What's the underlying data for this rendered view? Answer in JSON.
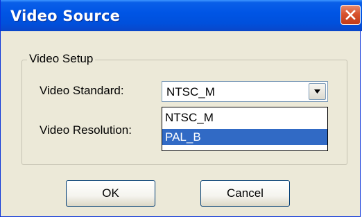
{
  "window": {
    "title": "Video Source"
  },
  "group": {
    "label": "Video Setup"
  },
  "fields": {
    "standard_label": "Video Standard:",
    "resolution_label": "Video Resolution:"
  },
  "combo": {
    "selected_value": "NTSC_M",
    "options": [
      "NTSC_M",
      "PAL_B"
    ],
    "highlighted_option": "PAL_B"
  },
  "buttons": {
    "ok": "OK",
    "cancel": "Cancel"
  },
  "icons": {
    "close": "close-icon",
    "dropdown": "chevron-down-icon"
  },
  "colors": {
    "titlebar": "#0055e5",
    "close_button": "#d8532e",
    "selection": "#316ac5",
    "dialog_bg": "#ece9d8"
  }
}
